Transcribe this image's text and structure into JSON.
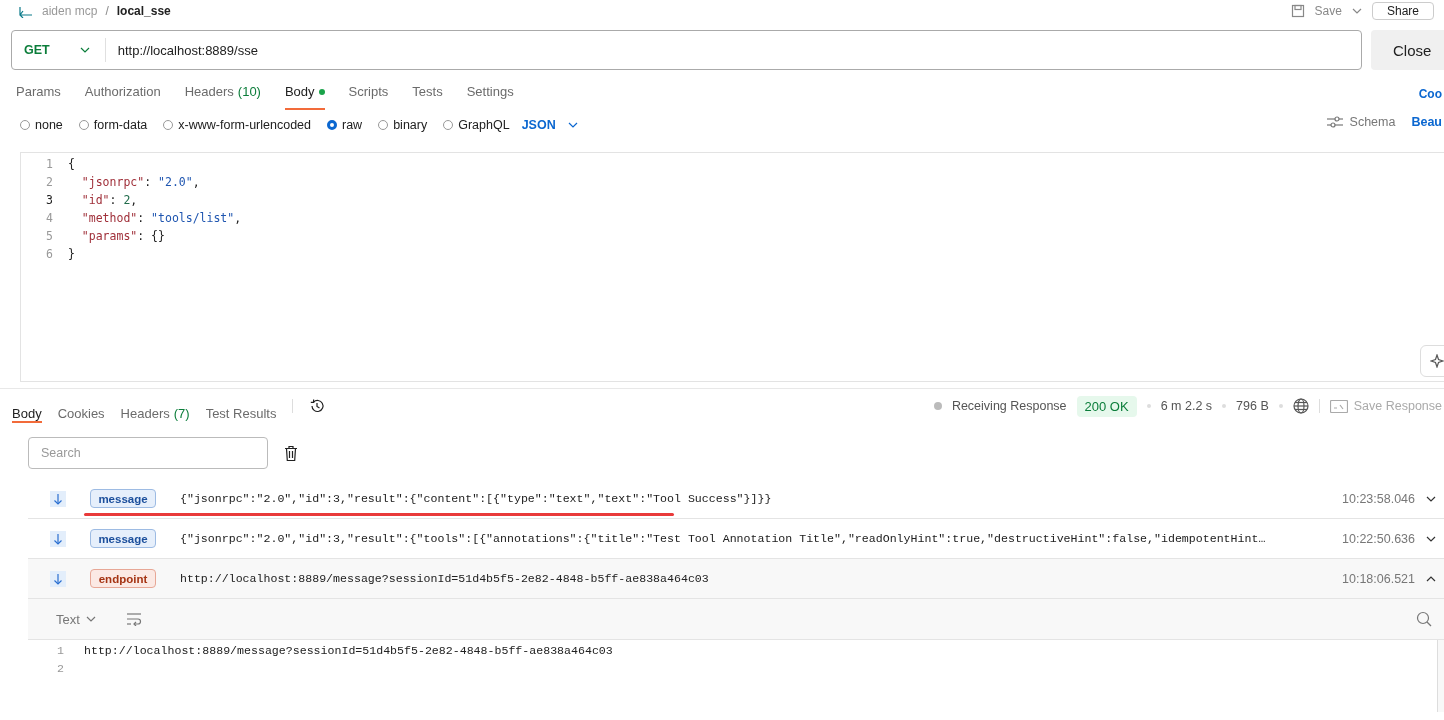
{
  "header": {
    "parent": "aiden mcp",
    "separator": "/",
    "current": "local_sse",
    "save": "Save",
    "share": "Share"
  },
  "request": {
    "method": "GET",
    "url": "http://localhost:8889/sse",
    "action": "Close"
  },
  "request_tabs": [
    {
      "label": "Params",
      "selected": false
    },
    {
      "label": "Authorization",
      "selected": false
    },
    {
      "label": "Headers",
      "count": "(10)",
      "selected": false
    },
    {
      "label": "Body",
      "selected": true,
      "has_content": true
    },
    {
      "label": "Scripts",
      "selected": false
    },
    {
      "label": "Tests",
      "selected": false
    },
    {
      "label": "Settings",
      "selected": false
    }
  ],
  "request_side_link": "Coo",
  "body_types": [
    {
      "label": "none",
      "selected": false
    },
    {
      "label": "form-data",
      "selected": false
    },
    {
      "label": "x-www-form-urlencoded",
      "selected": false
    },
    {
      "label": "raw",
      "selected": true
    },
    {
      "label": "binary",
      "selected": false
    },
    {
      "label": "GraphQL",
      "selected": false
    }
  ],
  "format": "JSON",
  "schema": "Schema",
  "beautify": "Beau",
  "editor": {
    "lines": [
      {
        "number": "1",
        "active": false,
        "tokens": [
          {
            "kind": "punct",
            "text": "{"
          }
        ]
      },
      {
        "number": "2",
        "active": false,
        "tokens": [
          {
            "kind": "key",
            "text": "  \"jsonrpc\""
          },
          {
            "kind": "punct",
            "text": ": "
          },
          {
            "kind": "string",
            "text": "\"2.0\""
          },
          {
            "kind": "punct",
            "text": ","
          }
        ]
      },
      {
        "number": "3",
        "active": true,
        "tokens": [
          {
            "kind": "key",
            "text": "  \"id\""
          },
          {
            "kind": "punct",
            "text": ": "
          },
          {
            "kind": "number",
            "text": "2"
          },
          {
            "kind": "punct",
            "text": ","
          }
        ]
      },
      {
        "number": "4",
        "active": false,
        "tokens": [
          {
            "kind": "key",
            "text": "  \"method\""
          },
          {
            "kind": "punct",
            "text": ": "
          },
          {
            "kind": "string",
            "text": "\"tools/list\""
          },
          {
            "kind": "punct",
            "text": ","
          }
        ]
      },
      {
        "number": "5",
        "active": false,
        "tokens": [
          {
            "kind": "key",
            "text": "  \"params\""
          },
          {
            "kind": "punct",
            "text": ": {}"
          }
        ]
      },
      {
        "number": "6",
        "active": false,
        "tokens": [
          {
            "kind": "punct",
            "text": "}"
          }
        ]
      }
    ]
  },
  "response": {
    "tabs": [
      {
        "label": "Body",
        "selected": true
      },
      {
        "label": "Cookies",
        "selected": false
      },
      {
        "label": "Headers",
        "count": "(7)",
        "selected": false
      },
      {
        "label": "Test Results",
        "selected": false
      }
    ],
    "status_text": "Receiving Response",
    "status": "200 OK",
    "time": "6 m 2.2 s",
    "size": "796 B",
    "save": "Save Response",
    "search": {
      "placeholder": "Search"
    },
    "events": [
      {
        "kind": "message",
        "type": "message",
        "data": "{\"jsonrpc\":\"2.0\",\"id\":3,\"result\":{\"content\":[{\"type\":\"text\",\"text\":\"Tool Success\"}]}}",
        "time": "10:23:58.046",
        "expanded": false,
        "highlighted": true
      },
      {
        "kind": "message",
        "type": "message",
        "data": "{\"jsonrpc\":\"2.0\",\"id\":3,\"result\":{\"tools\":[{\"annotations\":{\"title\":\"Test Tool Annotation Title\",\"readOnlyHint\":true,\"destructiveHint\":false,\"idempotentHint…",
        "time": "10:22:50.636",
        "expanded": false,
        "highlighted": false
      },
      {
        "kind": "endpoint",
        "type": "endpoint",
        "data": "http://localhost:8889/message?sessionId=51d4b5f5-2e82-4848-b5ff-ae838a464c03",
        "time": "10:18:06.521",
        "expanded": true,
        "highlighted": false
      }
    ],
    "viewer": {
      "format": "Text",
      "lines": [
        {
          "number": "1",
          "text": "http://localhost:8889/message?sessionId=51d4b5f5-2e82-4848-b5ff-ae838a464c03"
        },
        {
          "number": "2"
        }
      ]
    }
  }
}
